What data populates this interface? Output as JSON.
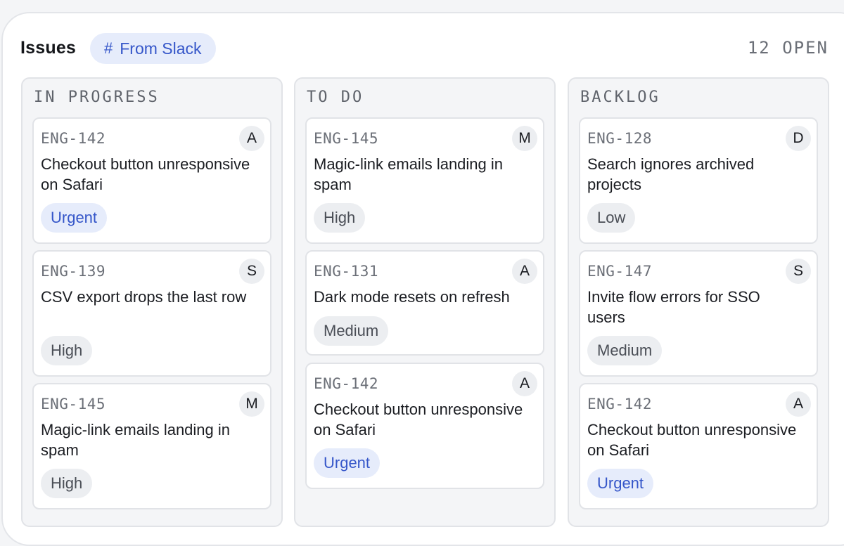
{
  "header": {
    "title": "Issues",
    "chip_icon": "#",
    "chip_label": "From Slack",
    "open_count": "12 OPEN"
  },
  "colors": {
    "accent": "#3556c9",
    "accent_bg": "#e6ecfb",
    "neutral_bg": "#eceef1",
    "column_bg": "#f4f5f7"
  },
  "columns": [
    {
      "title": "IN PROGRESS",
      "cards": [
        {
          "id": "ENG-142",
          "assignee": "A",
          "title": "Checkout button unresponsive on Safari",
          "priority": "Urgent"
        },
        {
          "id": "ENG-139",
          "assignee": "S",
          "title": "CSV export drops the last row",
          "priority": "High"
        },
        {
          "id": "ENG-145",
          "assignee": "M",
          "title": "Magic-link emails landing in spam",
          "priority": "High"
        }
      ]
    },
    {
      "title": "TO DO",
      "cards": [
        {
          "id": "ENG-145",
          "assignee": "M",
          "title": "Magic-link emails landing in spam",
          "priority": "High"
        },
        {
          "id": "ENG-131",
          "assignee": "A",
          "title": "Dark mode resets on refresh",
          "priority": "Medium"
        },
        {
          "id": "ENG-142",
          "assignee": "A",
          "title": "Checkout button unresponsive on Safari",
          "priority": "Urgent"
        }
      ]
    },
    {
      "title": "BACKLOG",
      "cards": [
        {
          "id": "ENG-128",
          "assignee": "D",
          "title": "Search ignores archived projects",
          "priority": "Low"
        },
        {
          "id": "ENG-147",
          "assignee": "S",
          "title": "Invite flow errors for SSO users",
          "priority": "Medium"
        },
        {
          "id": "ENG-142",
          "assignee": "A",
          "title": "Checkout button unresponsive on Safari",
          "priority": "Urgent"
        }
      ]
    }
  ]
}
